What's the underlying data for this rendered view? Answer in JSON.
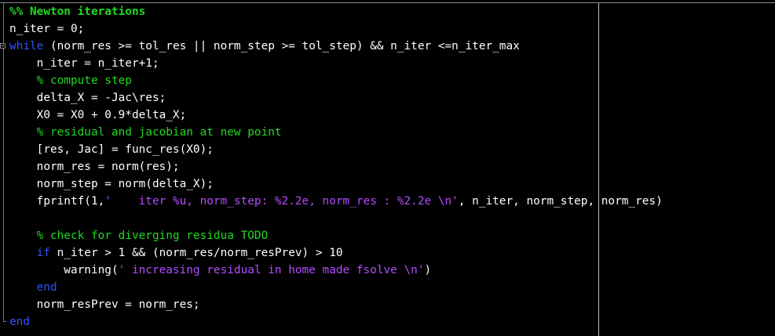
{
  "editor": {
    "colors": {
      "background": "#000000",
      "text": "#ffffff",
      "keyword": "#2f56ff",
      "comment": "#22d822",
      "string": "#b44bff"
    },
    "lines": [
      [
        {
          "t": "%% Newton iterations",
          "c": "cell"
        }
      ],
      [
        {
          "t": "n_iter = 0;",
          "c": "txt"
        }
      ],
      [
        {
          "t": "while",
          "c": "kw"
        },
        {
          "t": " (norm_res >= tol_res || norm_step >= tol_step) && n_iter <=n_iter_max",
          "c": "txt"
        }
      ],
      [
        {
          "t": "    n_iter = n_iter+1;",
          "c": "txt"
        }
      ],
      [
        {
          "t": "    ",
          "c": "txt"
        },
        {
          "t": "% compute step",
          "c": "cm"
        }
      ],
      [
        {
          "t": "    delta_X = -Jac\\res;",
          "c": "txt"
        }
      ],
      [
        {
          "t": "    X0 = X0 + 0.9*delta_X;",
          "c": "txt"
        }
      ],
      [
        {
          "t": "    ",
          "c": "txt"
        },
        {
          "t": "% residual and jacobian at new point",
          "c": "cm"
        }
      ],
      [
        {
          "t": "    [res, Jac] = func_res(X0);",
          "c": "txt"
        }
      ],
      [
        {
          "t": "    norm_res = norm(res);",
          "c": "txt"
        }
      ],
      [
        {
          "t": "    norm_step = norm(delta_X);",
          "c": "txt"
        }
      ],
      [
        {
          "t": "    fprintf(1,",
          "c": "txt"
        },
        {
          "t": "'    iter %u, norm_step: %2.2e, norm_res : %2.2e \\n'",
          "c": "str"
        },
        {
          "t": ", n_iter, norm_step, norm_res)",
          "c": "txt"
        }
      ],
      [
        {
          "t": "",
          "c": "txt"
        }
      ],
      [
        {
          "t": "    ",
          "c": "txt"
        },
        {
          "t": "% check for diverging residua TODO",
          "c": "cm"
        }
      ],
      [
        {
          "t": "    ",
          "c": "txt"
        },
        {
          "t": "if",
          "c": "kw"
        },
        {
          "t": " n_iter > 1 && (norm_res/norm_resPrev) > 10",
          "c": "txt"
        }
      ],
      [
        {
          "t": "        warning(",
          "c": "txt"
        },
        {
          "t": "' increasing residual in home made fsolve \\n'",
          "c": "str"
        },
        {
          "t": ")",
          "c": "txt"
        }
      ],
      [
        {
          "t": "    ",
          "c": "txt"
        },
        {
          "t": "end",
          "c": "kw"
        }
      ],
      [
        {
          "t": "    norm_resPrev = norm_res;",
          "c": "txt"
        }
      ],
      [
        {
          "t": "end",
          "c": "kw"
        }
      ]
    ]
  }
}
